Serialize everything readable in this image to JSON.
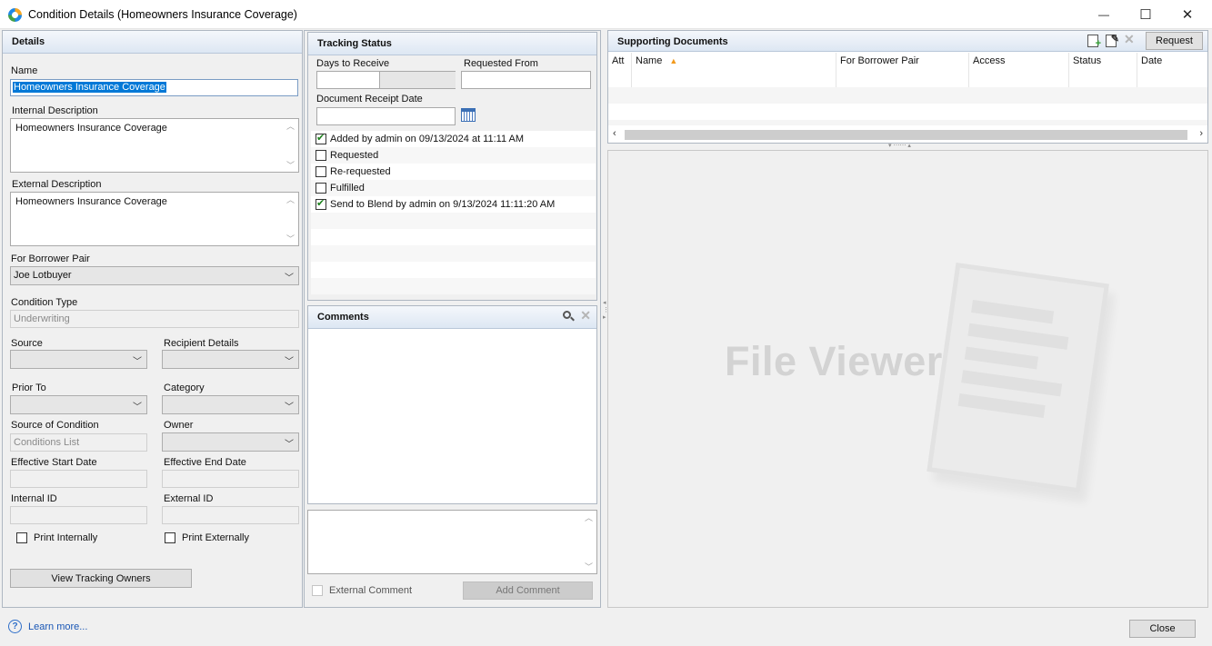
{
  "window": {
    "title": "Condition Details (Homeowners Insurance Coverage)",
    "minimize": "—",
    "maximize": "☐",
    "close": "✕"
  },
  "details": {
    "header": "Details",
    "name_label": "Name",
    "name_value": "Homeowners Insurance Coverage",
    "internal_desc_label": "Internal Description",
    "internal_desc_value": "Homeowners Insurance Coverage",
    "external_desc_label": "External Description",
    "external_desc_value": "Homeowners Insurance Coverage",
    "borrower_pair_label": "For Borrower Pair",
    "borrower_pair_value": "Joe Lotbuyer",
    "condition_type_label": "Condition Type",
    "condition_type_value": "Underwriting",
    "source_label": "Source",
    "recipient_details_label": "Recipient Details",
    "prior_to_label": "Prior To",
    "category_label": "Category",
    "source_of_condition_label": "Source of Condition",
    "source_of_condition_value": "Conditions List",
    "owner_label": "Owner",
    "eff_start_label": "Effective Start Date",
    "eff_end_label": "Effective End Date",
    "internal_id_label": "Internal ID",
    "external_id_label": "External ID",
    "print_internally": "Print Internally",
    "print_externally": "Print Externally",
    "view_tracking_owners": "View Tracking Owners"
  },
  "tracking": {
    "header": "Tracking Status",
    "days_to_receive_label": "Days to Receive",
    "requested_from_label": "Requested From",
    "doc_receipt_date_label": "Document Receipt Date",
    "rows": [
      {
        "label": "Added by admin on 09/13/2024 at 11:11 AM",
        "checked": true
      },
      {
        "label": "Requested",
        "checked": false
      },
      {
        "label": "Re-requested",
        "checked": false
      },
      {
        "label": "Fulfilled",
        "checked": false
      },
      {
        "label": "Send to Blend by admin on 9/13/2024 11:11:20 AM",
        "checked": true
      }
    ]
  },
  "comments": {
    "header": "Comments",
    "external_comment": "External Comment",
    "add_comment": "Add Comment"
  },
  "supporting": {
    "header": "Supporting Documents",
    "request_button": "Request",
    "columns": [
      "Att",
      "Name",
      "For Borrower Pair",
      "Access",
      "Status",
      "Date"
    ],
    "sort_indicator": "▲"
  },
  "file_viewer": {
    "watermark": "File Viewer"
  },
  "footer": {
    "learn_more": "Learn more...",
    "close": "Close",
    "help_icon": "?"
  },
  "colors": {
    "header_gradient_top": "#f4f7fb",
    "header_gradient_bottom": "#dde7f3",
    "selection": "#0078d7",
    "link": "#1a57b5"
  }
}
